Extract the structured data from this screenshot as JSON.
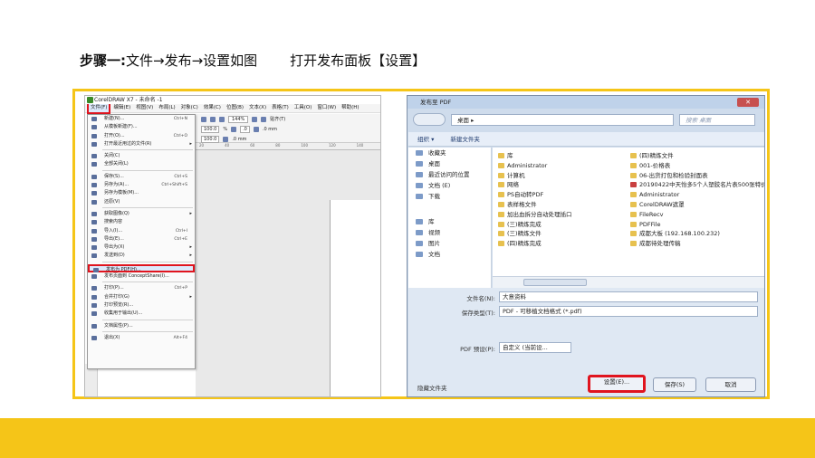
{
  "heading": {
    "step": "步骤一:",
    "path": "文件→发布→设置如图",
    "instruction": "打开发布面板【设置】"
  },
  "coreldraw": {
    "title": "CorelDRAW X7 - 未命名 -1",
    "menubar": [
      "文件(F)",
      "编辑(E)",
      "视图(V)",
      "布局(L)",
      "对象(C)",
      "效果(C)",
      "位图(B)",
      "文本(X)",
      "表格(T)",
      "工具(O)",
      "窗口(W)",
      "帮助(H)"
    ],
    "toolbar": {
      "zoom": "144%",
      "snap": "贴齐(T)",
      "width": "100.0",
      "height": "100.0",
      "unit": "%",
      "angle": ".0",
      "pos1": ".0 mm",
      "pos2": ".0 mm"
    },
    "ruler": [
      "20",
      "40",
      "60",
      "80",
      "100",
      "120",
      "140",
      "160"
    ],
    "file_menu": [
      {
        "label": "新建(N)...",
        "shortcut": "Ctrl+N"
      },
      {
        "label": "从模板新建(F)..."
      },
      {
        "label": "打开(O)...",
        "shortcut": "Ctrl+O"
      },
      {
        "label": "打开最近用过的文件(R)",
        "arrow": "▸"
      },
      {
        "sep": true
      },
      {
        "label": "关闭(C)"
      },
      {
        "label": "全部关闭(L)"
      },
      {
        "sep": true
      },
      {
        "label": "保存(S)...",
        "shortcut": "Ctrl+S"
      },
      {
        "label": "另存为(A)...",
        "shortcut": "Ctrl+Shift+S"
      },
      {
        "label": "另存为模板(M)..."
      },
      {
        "label": "还原(V)"
      },
      {
        "sep": true
      },
      {
        "label": "获取图像(Q)",
        "arrow": "▸"
      },
      {
        "label": "搜索内容"
      },
      {
        "label": "导入(I)...",
        "shortcut": "Ctrl+I"
      },
      {
        "label": "导出(E)...",
        "shortcut": "Ctrl+E"
      },
      {
        "label": "导出为(X)",
        "arrow": "▸"
      },
      {
        "label": "发送到(D)",
        "arrow": "▸"
      },
      {
        "sep": true
      },
      {
        "label": "发布为 PDF(H)...",
        "highlight": true
      },
      {
        "label": "发布页面到 ConceptShare(I)..."
      },
      {
        "sep": true
      },
      {
        "label": "打印(P)...",
        "shortcut": "Ctrl+P"
      },
      {
        "label": "合并打印(G)",
        "arrow": "▸"
      },
      {
        "label": "打印预览(R)..."
      },
      {
        "label": "收集用于输出(U)..."
      },
      {
        "sep": true
      },
      {
        "label": "文档属性(P)..."
      },
      {
        "sep": true
      },
      {
        "label": "退出(X)",
        "shortcut": "Alt+F4"
      }
    ]
  },
  "dialog": {
    "title": "发布至 PDF",
    "close": "✕",
    "path": "桌面 ▸",
    "search_placeholder": "搜索 桌面",
    "organize": "组织 ▾",
    "new_folder": "新建文件夹",
    "nav_items": [
      "收藏夹",
      "桌面",
      "最近访问的位置",
      "文档 (E)",
      "下载",
      "库",
      "视频",
      "图片",
      "文档"
    ],
    "files_col1": [
      "库",
      "Administrator",
      "计算机",
      "网络",
      "PS自动转PDF",
      "表样格文件",
      "加出血拆分自动处理插口",
      "(三)精炼完成",
      "(三)精炼文件",
      "(四)精炼完成"
    ],
    "files_col2": [
      "(四)精炼文件",
      "001-价格表",
      "06-出货打包和检验封面表",
      "20190422中天怡多5个人塑胶名片表500张特价版_最新",
      "Administrator",
      "CorelDRAW遮罩",
      "FileRecv",
      "PDFFile",
      "成都大板 (192.168.100.232)",
      "成都待处理传稿"
    ],
    "filename_label": "文件名(N):",
    "filename_value": "大意资料",
    "savetype_label": "保存类型(T):",
    "savetype_value": "PDF - 可移植文档格式 (*.pdf)",
    "preset_label": "PDF 预设(P):",
    "preset_value": "自定义 (当前设...",
    "hide_folders": "隐藏文件夹",
    "settings_btn": "设置(E)...",
    "save_btn": "保存(S)",
    "cancel_btn": "取消"
  },
  "colors": {
    "accent": "#f5c518",
    "highlight": "#e0141e"
  }
}
